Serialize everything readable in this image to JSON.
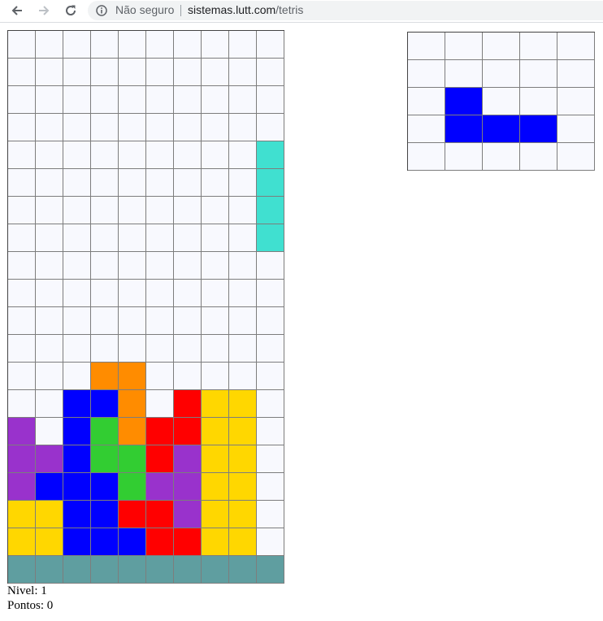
{
  "browser": {
    "back_icon": "arrow-left-icon",
    "forward_icon": "arrow-right-icon",
    "reload_icon": "reload-icon",
    "security_icon": "info-icon",
    "security_label": "Não seguro",
    "url_host": "sistemas.lutt.com",
    "url_path": "/tetris"
  },
  "colors": {
    "e": "#f8f9fe",
    "c": "#40e0d0",
    "b": "#0000ff",
    "o": "#ff8c00",
    "r": "#ff0000",
    "y": "#ffd700",
    "p": "#9932cc",
    "g": "#32cd32",
    "f": "#5f9ea0"
  },
  "board": {
    "columns": 10,
    "rows": [
      "eeeeeeeeee",
      "eeeeeeeeee",
      "eeeeeeeeee",
      "eeeeeeeeee",
      "eeeeeeeeec",
      "eeeeeeeeec",
      "eeeeeeeeec",
      "eeeeeeeeec",
      "eeeeeeeeee",
      "eeeeeeeeee",
      "eeeeeeeeee",
      "eeeeeeeeee",
      "eeeooeeeee",
      "eebboeryye",
      "pebgorryye",
      "ppbggrpyye",
      "pbbbgppyye",
      "yybbrrpyye",
      "yybbbrryye",
      "ffffffffff"
    ]
  },
  "next_piece": {
    "columns": 5,
    "rows": [
      "eeeee",
      "eeeee",
      "ebeee",
      "ebbbe",
      "eeeee"
    ]
  },
  "status": {
    "level_label": "Nivel:",
    "level_value": "1",
    "points_label": "Pontos:",
    "points_value": "0"
  }
}
